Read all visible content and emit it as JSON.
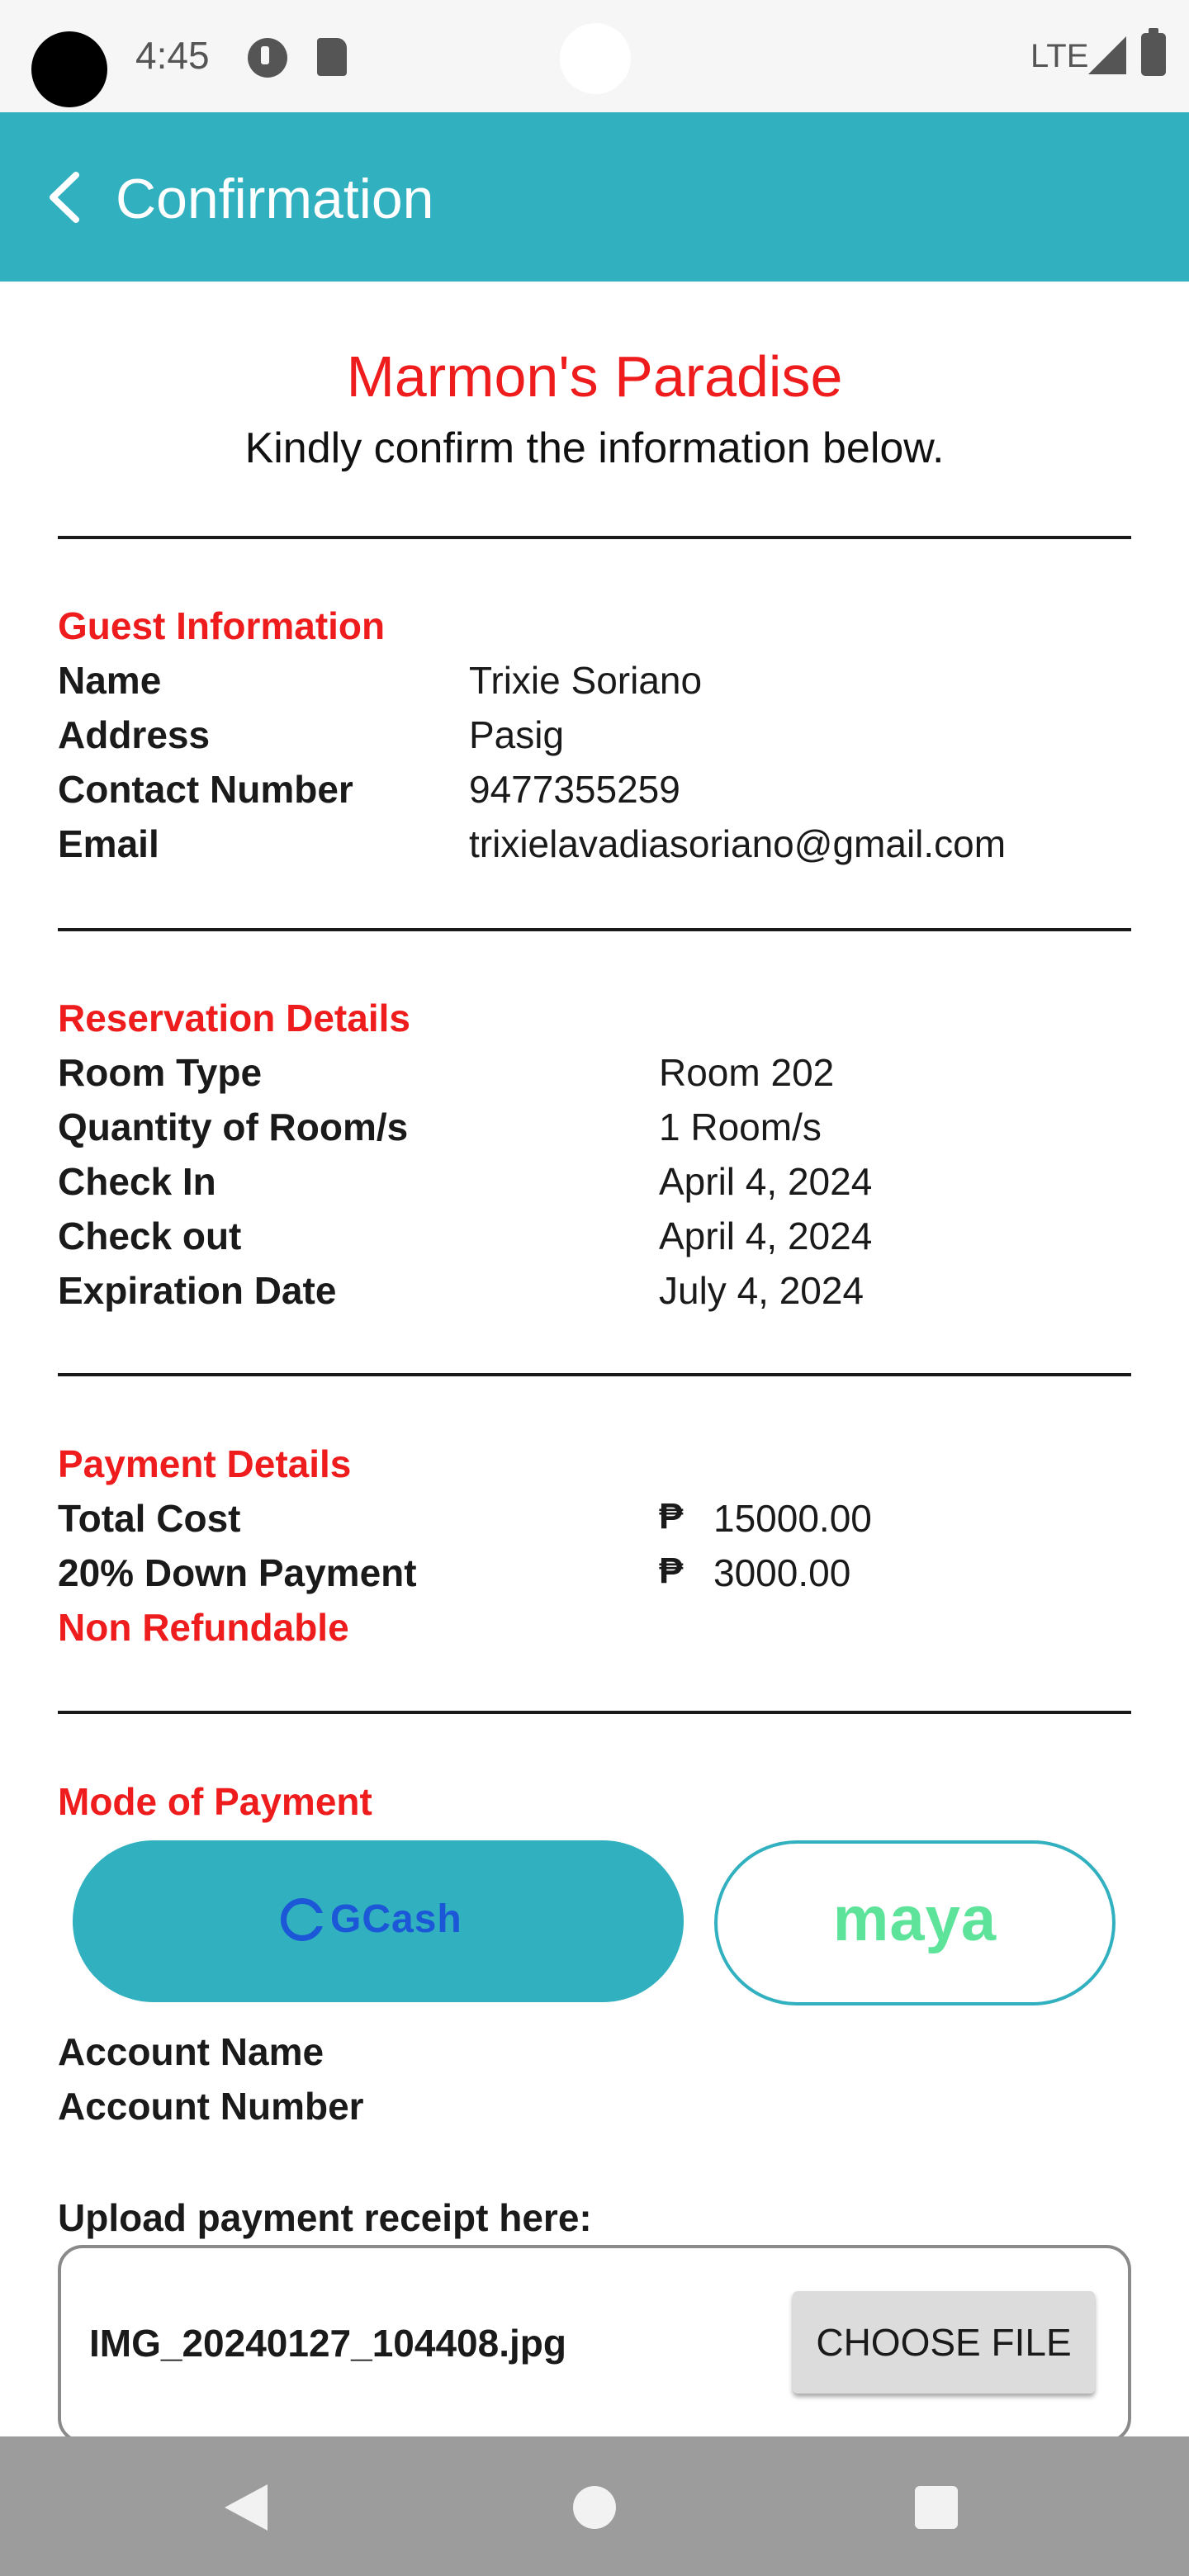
{
  "status_bar": {
    "time": "4:45",
    "network": "LTE"
  },
  "app_bar": {
    "title": "Confirmation"
  },
  "header": {
    "resort_name": "Marmon's Paradise",
    "subtitle": "Kindly confirm the information below."
  },
  "guest_info": {
    "title": "Guest Information",
    "rows": [
      {
        "label": "Name",
        "value": "Trixie Soriano"
      },
      {
        "label": "Address",
        "value": "Pasig"
      },
      {
        "label": "Contact Number",
        "value": "9477355259"
      },
      {
        "label": "Email",
        "value": "trixielavadiasoriano@gmail.com"
      }
    ]
  },
  "reservation": {
    "title": "Reservation Details",
    "rows": [
      {
        "label": "Room Type",
        "value": "Room 202"
      },
      {
        "label": "Quantity of Room/s",
        "value": "1 Room/s"
      },
      {
        "label": "Check In",
        "value": "April 4, 2024"
      },
      {
        "label": "Check out",
        "value": "April 4, 2024"
      },
      {
        "label": "Expiration Date",
        "value": "July 4, 2024"
      }
    ]
  },
  "payment": {
    "title": "Payment Details",
    "currency": "₱",
    "rows": [
      {
        "label": "Total Cost",
        "value": "15000.00"
      },
      {
        "label": "20% Down Payment",
        "value": "3000.00"
      }
    ],
    "note": "Non Refundable"
  },
  "mode_of_payment": {
    "title": "Mode of Payment",
    "gcash_label": "GCash",
    "maya_label": "maya",
    "account_name_label": "Account Name",
    "account_number_label": "Account Number"
  },
  "upload": {
    "label": "Upload payment receipt here:",
    "filename": "IMG_20240127_104408.jpg",
    "button": "CHOOSE FILE"
  },
  "colors": {
    "accent": "#31b0bf",
    "red": "#ee1c1c",
    "gcash_blue": "#1b57d6",
    "maya_green": "#5ee39b"
  }
}
